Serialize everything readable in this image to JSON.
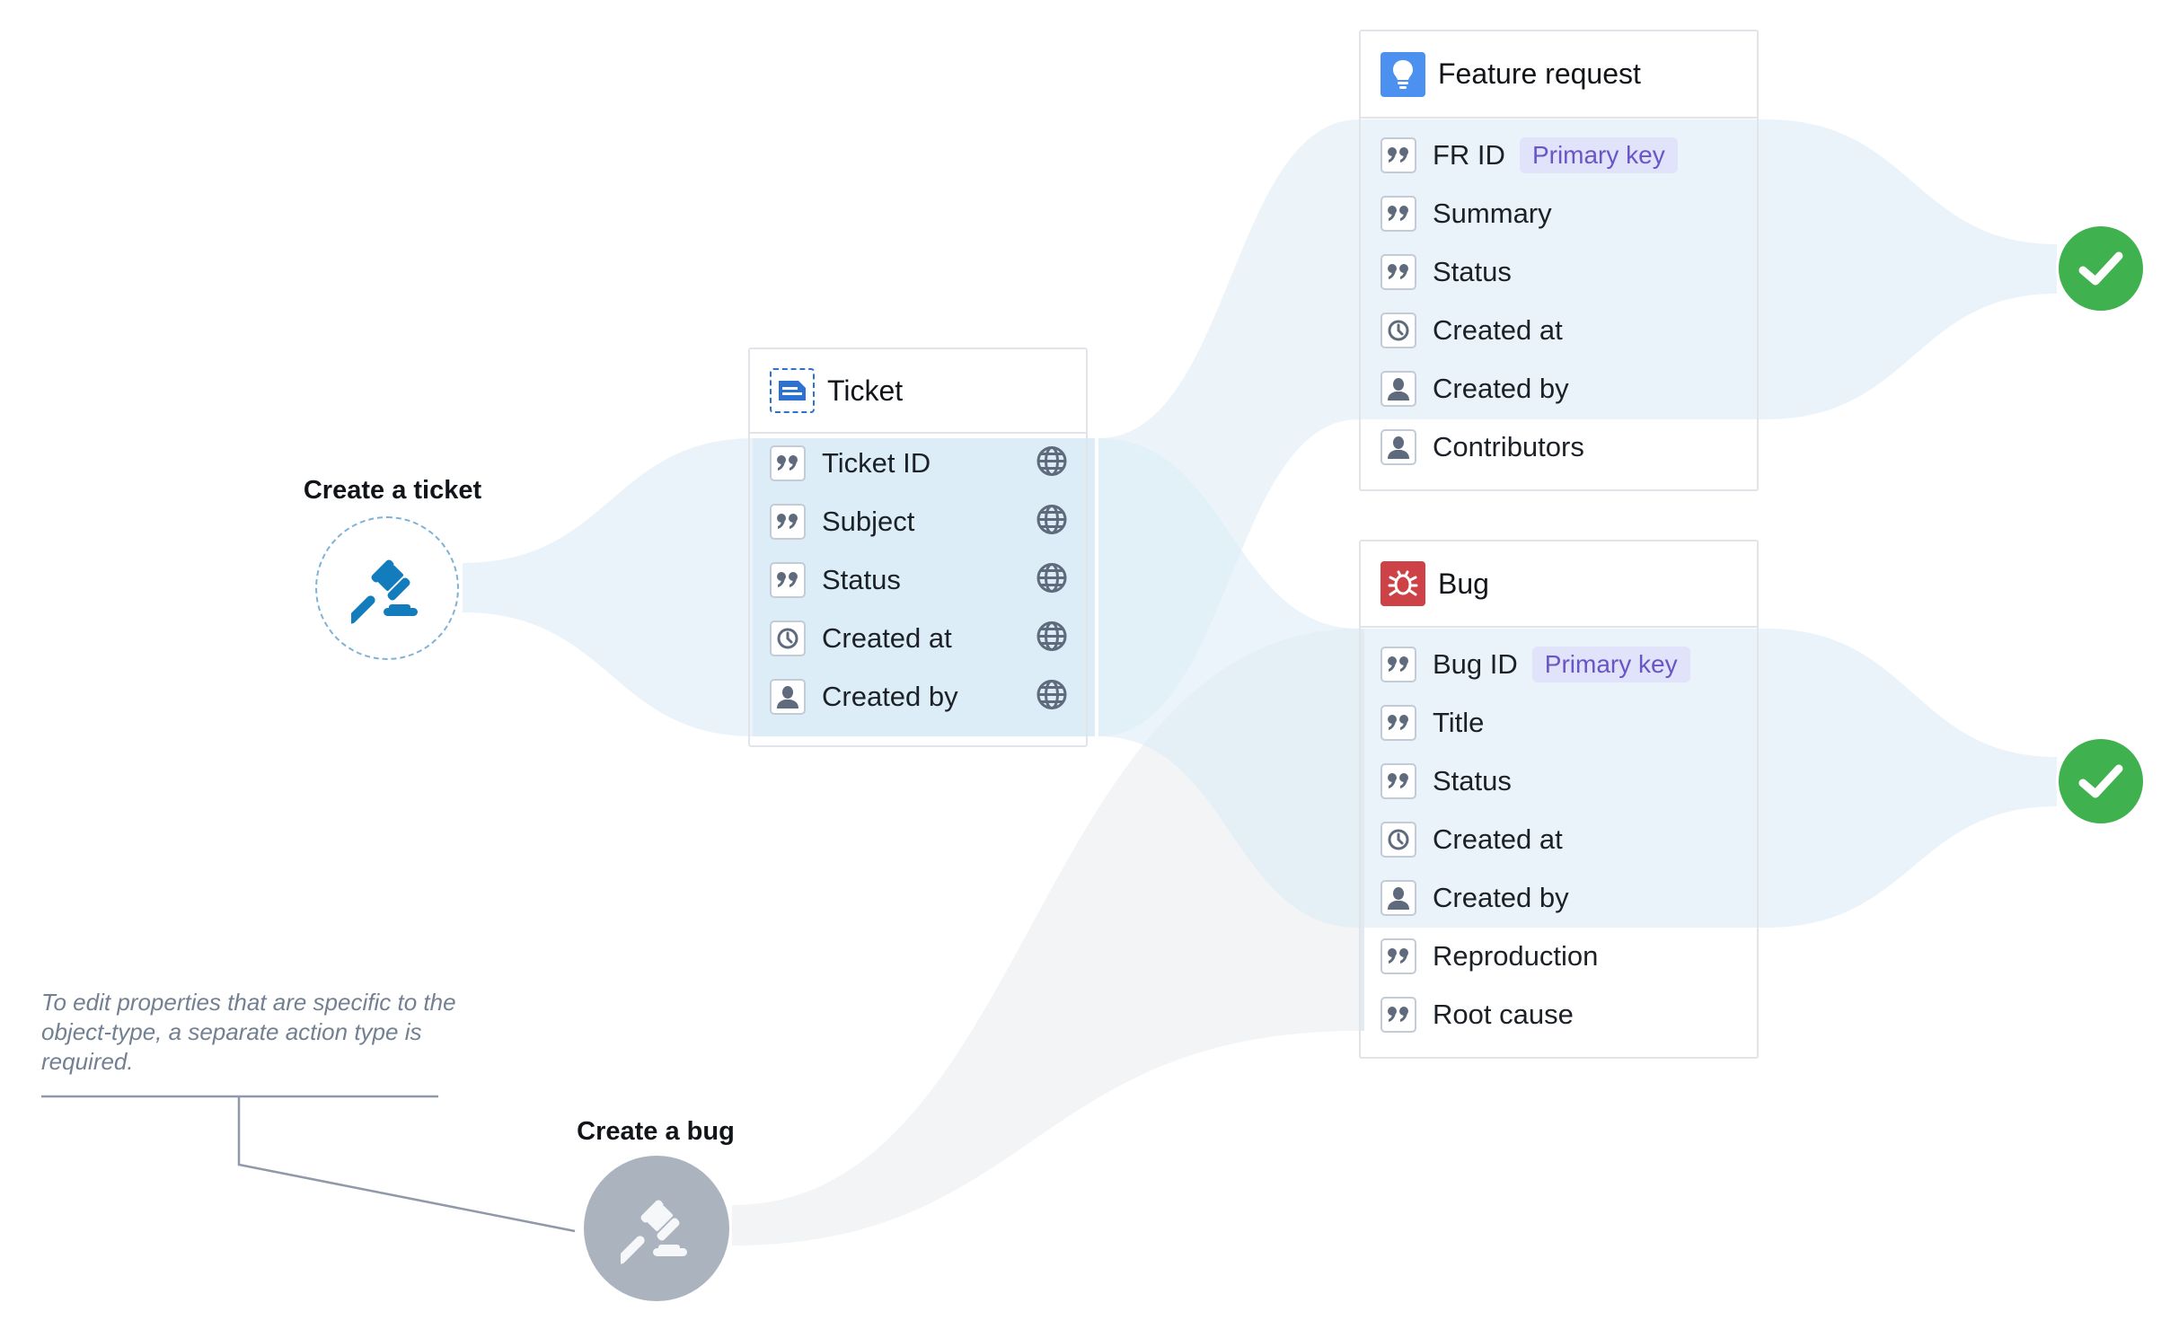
{
  "actions": {
    "create_ticket": {
      "label": "Create a ticket",
      "icon": "gavel-icon",
      "style": "dashed"
    },
    "create_bug": {
      "label": "Create a bug",
      "icon": "gavel-icon",
      "style": "disabled"
    }
  },
  "objects": {
    "ticket": {
      "title": "Ticket",
      "icon": "document-icon",
      "properties": [
        {
          "label": "Ticket ID",
          "type": "string",
          "shared": true
        },
        {
          "label": "Subject",
          "type": "string",
          "shared": true
        },
        {
          "label": "Status",
          "type": "string",
          "shared": true
        },
        {
          "label": "Created at",
          "type": "timestamp",
          "shared": true
        },
        {
          "label": "Created by",
          "type": "user",
          "shared": true
        }
      ]
    },
    "feature_request": {
      "title": "Feature request",
      "icon": "lightbulb-icon",
      "properties": [
        {
          "label": "FR ID",
          "type": "string",
          "badge": "Primary key"
        },
        {
          "label": "Summary",
          "type": "string"
        },
        {
          "label": "Status",
          "type": "string"
        },
        {
          "label": "Created at",
          "type": "timestamp"
        },
        {
          "label": "Created by",
          "type": "user"
        },
        {
          "label": "Contributors",
          "type": "user"
        }
      ]
    },
    "bug": {
      "title": "Bug",
      "icon": "bug-icon",
      "properties": [
        {
          "label": "Bug ID",
          "type": "string",
          "badge": "Primary key"
        },
        {
          "label": "Title",
          "type": "string"
        },
        {
          "label": "Status",
          "type": "string"
        },
        {
          "label": "Created at",
          "type": "timestamp"
        },
        {
          "label": "Created by",
          "type": "user"
        },
        {
          "label": "Reproduction",
          "type": "string"
        },
        {
          "label": "Root cause",
          "type": "string"
        }
      ]
    }
  },
  "status": {
    "feature_request": "success",
    "bug": "success"
  },
  "note": {
    "text": "To edit properties that are specific to the object-type, a separate action type is required."
  },
  "colors": {
    "flow_blue": "#eaf3fa",
    "flow_blue_dark": "#dcedf7",
    "flow_gray": "#f2f4f6",
    "check_green": "#3fb24f",
    "badge_bg": "#e0e3fa",
    "badge_text": "#6a55c7",
    "feature_icon_bg": "#4c90f0",
    "bug_icon_bg": "#cd4246",
    "ticket_icon": "#2d72d2",
    "gavel_blue": "#137cbd",
    "leader_line": "#8f99a8"
  }
}
